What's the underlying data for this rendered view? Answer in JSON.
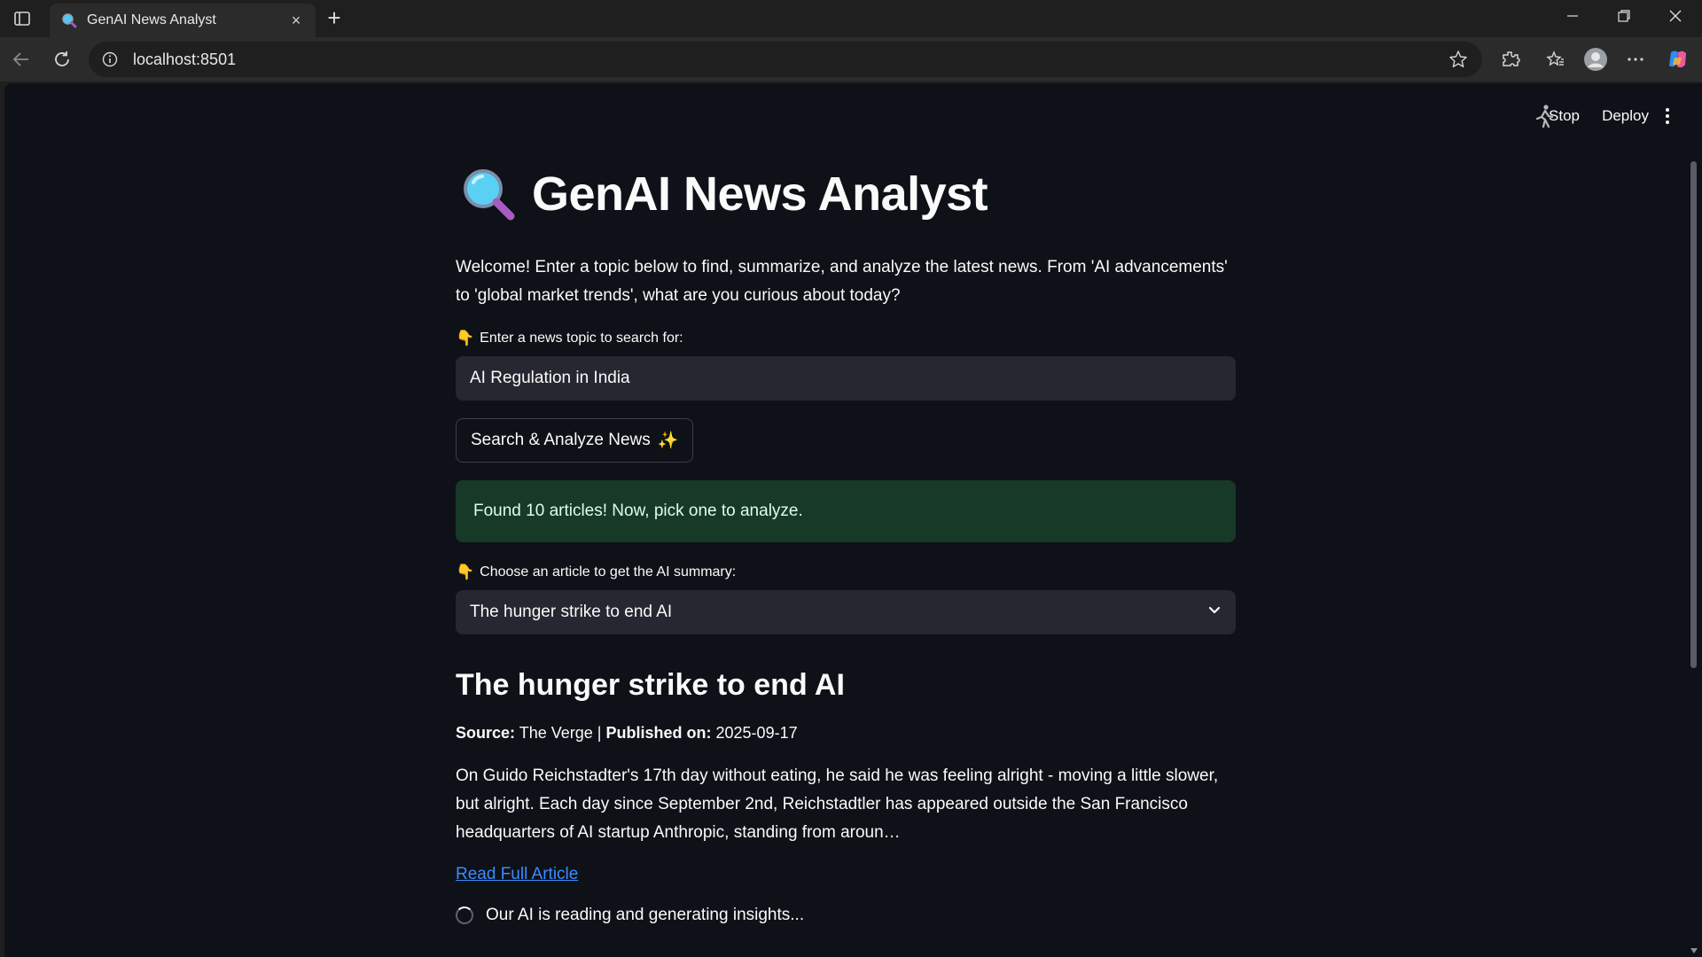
{
  "browser": {
    "tab_title": "GenAI News Analyst",
    "url": "localhost:8501",
    "new_tab": "+",
    "close_tab": "×"
  },
  "app_header": {
    "stop_label": "Stop",
    "deploy_label": "Deploy"
  },
  "main": {
    "title": "GenAI News Analyst",
    "intro": "Welcome! Enter a topic below to find, summarize, and analyze the latest news. From 'AI advancements' to 'global market trends', what are you curious about today?",
    "topic_label": "Enter a news topic to search for:",
    "topic_value": "AI Regulation in India",
    "search_button": "Search & Analyze News",
    "search_button_emoji": "✨",
    "hand_emoji": "👇",
    "success_message": "Found 10 articles! Now, pick one to analyze.",
    "choose_label": "Choose an article to get the AI summary:",
    "selected_article": "The hunger strike to end AI",
    "article": {
      "title": "The hunger strike to end AI",
      "source_label": "Source:",
      "source": "The Verge",
      "separator": "|",
      "published_label": "Published on:",
      "published": "2025-09-17",
      "description": "On Guido Reichstadter's 17th day without eating, he said he was feeling alright - moving a little slower, but alright. Each day since September 2nd, Reichstadtler has appeared outside the San Francisco headquarters of AI startup Anthropic, standing from aroun…",
      "read_more": "Read Full Article"
    },
    "spinner_text": "Our AI is reading and generating insights..."
  },
  "colors": {
    "app_bg": "#0e1117",
    "input_bg": "#262730",
    "success_bg": "#173928",
    "link": "#3b8cff"
  }
}
